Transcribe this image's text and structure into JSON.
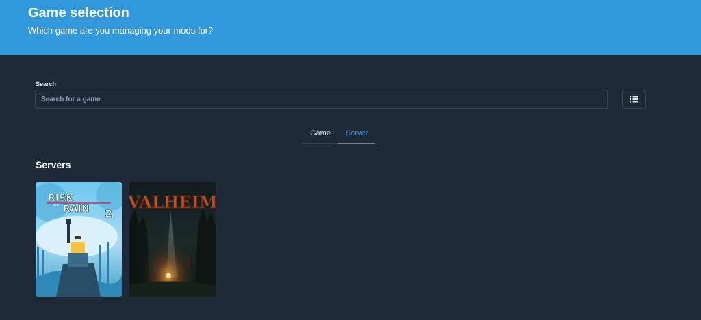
{
  "header": {
    "title": "Game selection",
    "subtitle": "Which game are you managing your mods for?"
  },
  "search": {
    "label": "Search",
    "placeholder": "Search for a game",
    "value": ""
  },
  "view_toggle": {
    "icon": "list-view-icon"
  },
  "tabs": [
    {
      "label": "Game",
      "active": false
    },
    {
      "label": "Server",
      "active": true
    }
  ],
  "section": {
    "title": "Servers"
  },
  "cards": [
    {
      "name": "Risk of Rain 2",
      "logo_lines": [
        "RISK",
        "OF",
        "RAIN",
        "2"
      ]
    },
    {
      "name": "Valheim",
      "logo": "VALHEIM"
    }
  ],
  "colors": {
    "header_bg": "#3298dc",
    "page_bg": "#1f2a38",
    "accent": "#3d94e6"
  }
}
